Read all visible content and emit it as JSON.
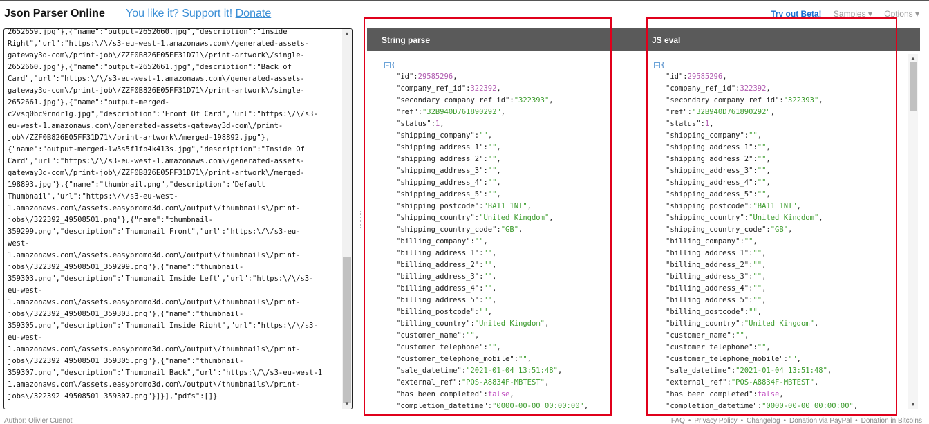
{
  "header": {
    "app_title": "Json Parser Online",
    "support_text": "You like it? Support it! ",
    "donate_label": "Donate",
    "nav": {
      "beta_label": "Try out Beta!",
      "samples_label": "Samples ▾",
      "options_label": "Options ▾"
    }
  },
  "editor": {
    "lines": [
      "2652659.jpg\"},{\"name\":\"output-2652660.jpg\",\"description\":\"Inside",
      "Right\",\"url\":\"https:\\/\\/s3-eu-west-1.amazonaws.com\\/generated-assets-",
      "gateway3d-com\\/print-job\\/ZZF0B826E05FF31D71\\/print-artwork\\/single-",
      "2652660.jpg\"},{\"name\":\"output-2652661.jpg\",\"description\":\"Back of",
      "Card\",\"url\":\"https:\\/\\/s3-eu-west-1.amazonaws.com\\/generated-assets-",
      "gateway3d-com\\/print-job\\/ZZF0B826E05FF31D71\\/print-artwork\\/single-",
      "2652661.jpg\"},{\"name\":\"output-merged-",
      "c2vsq0bc9rndr1g.jpg\",\"description\":\"Front Of Card\",\"url\":\"https:\\/\\/s3-",
      "eu-west-1.amazonaws.com\\/generated-assets-gateway3d-com\\/print-",
      "job\\/ZZF0B826E05FF31D71\\/print-artwork\\/merged-198892.jpg\"},",
      "{\"name\":\"output-merged-lw5s5f1fb4k413s.jpg\",\"description\":\"Inside Of",
      "Card\",\"url\":\"https:\\/\\/s3-eu-west-1.amazonaws.com\\/generated-assets-",
      "gateway3d-com\\/print-job\\/ZZF0B826E05FF31D71\\/print-artwork\\/merged-",
      "198893.jpg\"},{\"name\":\"thumbnail.png\",\"description\":\"Default",
      "Thumbnail\",\"url\":\"https:\\/\\/s3-eu-west-",
      "1.amazonaws.com\\/assets.easypromo3d.com\\/output\\/thumbnails\\/print-",
      "jobs\\/322392_49508501.png\"},{\"name\":\"thumbnail-",
      "359299.png\",\"description\":\"Thumbnail Front\",\"url\":\"https:\\/\\/s3-eu-",
      "west-",
      "1.amazonaws.com\\/assets.easypromo3d.com\\/output\\/thumbnails\\/print-",
      "jobs\\/322392_49508501_359299.png\"},{\"name\":\"thumbnail-",
      "359303.png\",\"description\":\"Thumbnail Inside Left\",\"url\":\"https:\\/\\/s3-",
      "eu-west-",
      "1.amazonaws.com\\/assets.easypromo3d.com\\/output\\/thumbnails\\/print-",
      "jobs\\/322392_49508501_359303.png\"},{\"name\":\"thumbnail-",
      "359305.png\",\"description\":\"Thumbnail Inside Right\",\"url\":\"https:\\/\\/s3-",
      "eu-west-",
      "1.amazonaws.com\\/assets.easypromo3d.com\\/output\\/thumbnails\\/print-",
      "jobs\\/322392_49508501_359305.png\"},{\"name\":\"thumbnail-",
      "359307.png\",\"description\":\"Thumbnail Back\",\"url\":\"https:\\/\\/s3-eu-west-1",
      "1.amazonaws.com\\/assets.easypromo3d.com\\/output\\/thumbnails\\/print-",
      "jobs\\/322392_49508501_359307.png\"}]}],\"pdfs\":[]}",
      ""
    ]
  },
  "panels": {
    "string_parse_title": "String parse",
    "js_eval_title": "JS eval",
    "open_brace": "{",
    "collapse_symbol": "−",
    "fields": [
      {
        "key": "\"id\"",
        "value": "29585296",
        "type": "num"
      },
      {
        "key": "\"company_ref_id\"",
        "value": "322392",
        "type": "num"
      },
      {
        "key": "\"secondary_company_ref_id\"",
        "value": "\"322393\"",
        "type": "str"
      },
      {
        "key": "\"ref\"",
        "value": "\"32B940D761890292\"",
        "type": "str"
      },
      {
        "key": "\"status\"",
        "value": "1",
        "type": "num"
      },
      {
        "key": "\"shipping_company\"",
        "value": "\"\"",
        "type": "str"
      },
      {
        "key": "\"shipping_address_1\"",
        "value": "\"\"",
        "type": "str"
      },
      {
        "key": "\"shipping_address_2\"",
        "value": "\"\"",
        "type": "str"
      },
      {
        "key": "\"shipping_address_3\"",
        "value": "\"\"",
        "type": "str"
      },
      {
        "key": "\"shipping_address_4\"",
        "value": "\"\"",
        "type": "str"
      },
      {
        "key": "\"shipping_address_5\"",
        "value": "\"\"",
        "type": "str"
      },
      {
        "key": "\"shipping_postcode\"",
        "value": "\"BA11 1NT\"",
        "type": "str"
      },
      {
        "key": "\"shipping_country\"",
        "value": "\"United Kingdom\"",
        "type": "str"
      },
      {
        "key": "\"shipping_country_code\"",
        "value": "\"GB\"",
        "type": "str"
      },
      {
        "key": "\"billing_company\"",
        "value": "\"\"",
        "type": "str"
      },
      {
        "key": "\"billing_address_1\"",
        "value": "\"\"",
        "type": "str"
      },
      {
        "key": "\"billing_address_2\"",
        "value": "\"\"",
        "type": "str"
      },
      {
        "key": "\"billing_address_3\"",
        "value": "\"\"",
        "type": "str"
      },
      {
        "key": "\"billing_address_4\"",
        "value": "\"\"",
        "type": "str"
      },
      {
        "key": "\"billing_address_5\"",
        "value": "\"\"",
        "type": "str"
      },
      {
        "key": "\"billing_postcode\"",
        "value": "\"\"",
        "type": "str"
      },
      {
        "key": "\"billing_country\"",
        "value": "\"United Kingdom\"",
        "type": "str"
      },
      {
        "key": "\"customer_name\"",
        "value": "\"\"",
        "type": "str"
      },
      {
        "key": "\"customer_telephone\"",
        "value": "\"\"",
        "type": "str"
      },
      {
        "key": "\"customer_telephone_mobile\"",
        "value": "\"\"",
        "type": "str"
      },
      {
        "key": "\"sale_datetime\"",
        "value": "\"2021-01-04 13:51:48\"",
        "type": "str"
      },
      {
        "key": "\"external_ref\"",
        "value": "\"POS-A8834F-MBTEST\"",
        "type": "str"
      },
      {
        "key": "\"has_been_completed\"",
        "value": "false",
        "type": "bool"
      },
      {
        "key": "\"completion_datetime\"",
        "value": "\"0000-00-00 00:00:00\"",
        "type": "str"
      }
    ]
  },
  "footer": {
    "author": "Author: Olivier Cuenot",
    "links": [
      "FAQ",
      "Privacy Policy",
      "Changelog",
      "Donation via PayPal",
      "Donation in Bitcoins"
    ],
    "separator": "•"
  },
  "colors": {
    "highlight_box": "#e0001b",
    "panel_header": "#5a5a5a",
    "link_blue": "#3b8fd6",
    "number": "#b05ab0",
    "string": "#3c9b2d"
  }
}
